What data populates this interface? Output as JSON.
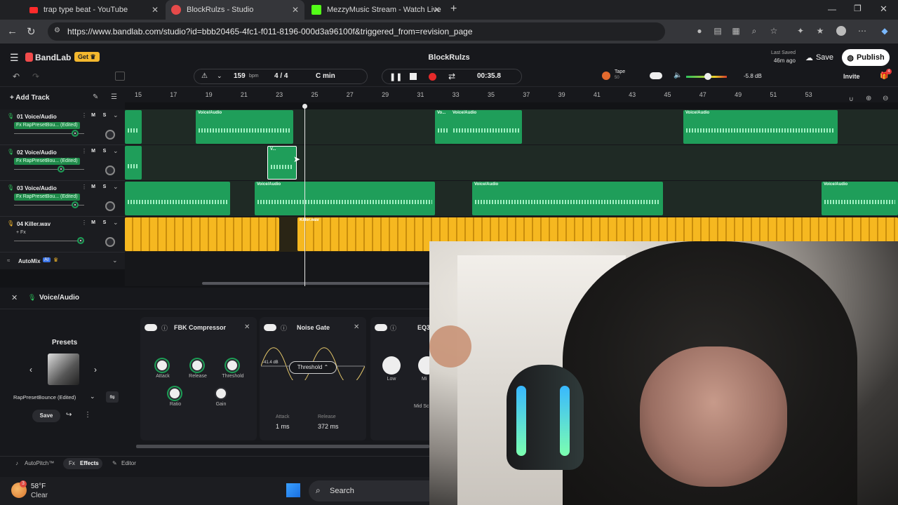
{
  "browser": {
    "tabs": [
      {
        "title": "trap type beat - YouTube",
        "active": false
      },
      {
        "title": "BlockRulzs - Studio",
        "active": true
      },
      {
        "title": "MezzyMusic Stream - Watch Live",
        "active": false
      }
    ],
    "url": "https://www.bandlab.com/studio?id=bbb20465-4fc1-f011-8196-000d3a96100f&triggered_from=revision_page"
  },
  "app": {
    "brand": "BandLab",
    "get_label": "Get",
    "project_title": "BlockRulzs",
    "last_saved_label": "Last Saved",
    "last_saved_time": "46m ago",
    "save_label": "Save",
    "publish_label": "Publish",
    "invite_label": "Invite",
    "notification_count": "4"
  },
  "transport": {
    "bpm": "159",
    "bpm_unit": "bpm",
    "time_sig": "4 / 4",
    "key": "C min",
    "time": "00:35.8",
    "tape_label": "Tape",
    "tape_value": "50",
    "volume_db": "-5.8 dB"
  },
  "ruler": [
    "15",
    "17",
    "19",
    "21",
    "23",
    "25",
    "27",
    "29",
    "31",
    "33",
    "35",
    "37",
    "39",
    "41",
    "43",
    "45",
    "47",
    "49",
    "51",
    "53"
  ],
  "add_track_label": "Add Track",
  "tracks": [
    {
      "name": "01  Voice/Audio",
      "fx": "Fx RapPresetBou... (Edited)",
      "m": "M",
      "s": "S"
    },
    {
      "name": "02  Voice/Audio",
      "fx": "Fx RapPresetBou... (Edited)",
      "m": "M",
      "s": "S"
    },
    {
      "name": "03  Voice/Audio",
      "fx": "Fx RapPresetBou... (Edited)",
      "m": "M",
      "s": "S"
    },
    {
      "name": "04  Killer.wav",
      "fx": "+ Fx",
      "m": "M",
      "s": "S"
    }
  ],
  "clip_labels": {
    "voice": "Voice/Audio",
    "short": "Vo...",
    "small": "V...",
    "killer": "Killer.wav"
  },
  "automix": {
    "label": "AutoMix",
    "badge": "AI"
  },
  "panel": {
    "title": "Voice/Audio",
    "presets_label": "Presets",
    "preset_name": "RapPresetBounce (Edited)",
    "save_label": "Save",
    "compressor": {
      "title": "FBK Compressor",
      "knobs": [
        "Attack",
        "Release",
        "Threshold",
        "Ratio",
        "Gain"
      ]
    },
    "gate": {
      "title": "Noise Gate",
      "level": "-41.4 dB",
      "threshold": "Threshold",
      "attack_label": "Attack",
      "attack_value": "1 ms",
      "release_label": "Release",
      "release_value": "372 ms"
    },
    "eq": {
      "title": "EQ3",
      "knobs": [
        "Low",
        "Mi",
        "Mid Sc"
      ]
    },
    "bottom_tabs": [
      "AutoPitch™",
      "Effects",
      "Editor"
    ]
  },
  "taskbar": {
    "temp": "58°F",
    "weather": "Clear",
    "search": "Search",
    "badge": "3"
  }
}
